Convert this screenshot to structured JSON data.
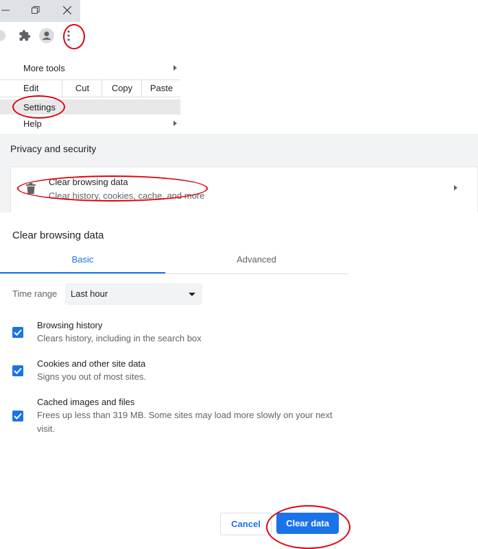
{
  "menu": {
    "more_tools": "More tools",
    "edit": "Edit",
    "cut": "Cut",
    "copy": "Copy",
    "paste": "Paste",
    "settings": "Settings",
    "help": "Help"
  },
  "settings_page": {
    "section_title": "Privacy and security",
    "clear_item_title": "Clear browsing data",
    "clear_item_subtitle": "Clear history, cookies, cache, and more"
  },
  "dialog": {
    "title": "Clear browsing data",
    "tabs": [
      {
        "label": "Basic",
        "active": true
      },
      {
        "label": "Advanced",
        "active": false
      }
    ],
    "time_range_label": "Time range",
    "time_range_value": "Last hour",
    "options": [
      {
        "title": "Browsing history",
        "subtitle": "Clears history, including in the search box",
        "checked": true
      },
      {
        "title": "Cookies and other site data",
        "subtitle": "Signs you out of most sites.",
        "checked": true
      },
      {
        "title": "Cached images and files",
        "subtitle": "Frees up less than 319 MB. Some sites may load more slowly on your next visit.",
        "checked": true
      }
    ],
    "cancel_label": "Cancel",
    "clear_label": "Clear data"
  },
  "icons": [
    "minimize-icon",
    "restore-icon",
    "close-icon",
    "star-icon",
    "extensions-icon",
    "profile-icon",
    "more-vert-icon",
    "trash-icon",
    "chevron-right-icon",
    "check-icon"
  ],
  "colors": {
    "accent": "#1a73e8",
    "annotation": "#e0000b"
  }
}
